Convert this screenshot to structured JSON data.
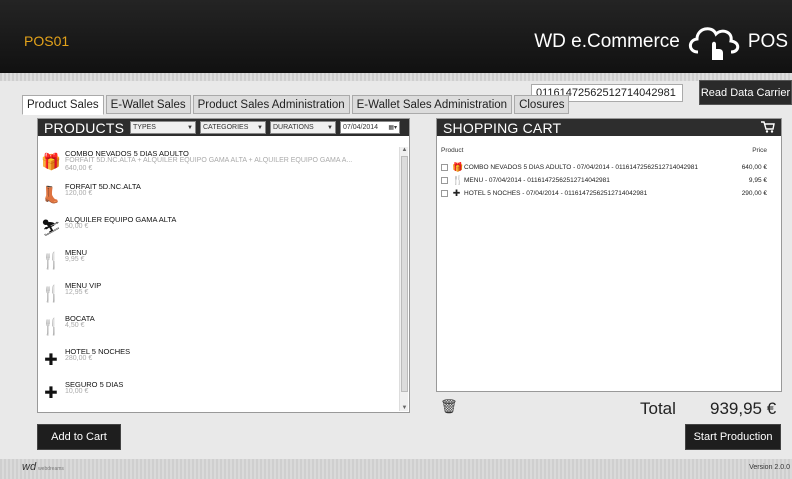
{
  "header": {
    "pos_id": "POS01",
    "brand_left": "WD e.Commerce",
    "brand_right": "POS"
  },
  "carrier": {
    "code": "01161472562512714042981",
    "read_label": "Read Data Carrier"
  },
  "tabs": [
    {
      "label": "Product Sales",
      "active": true
    },
    {
      "label": "E-Wallet Sales",
      "active": false
    },
    {
      "label": "Product Sales Administration",
      "active": false
    },
    {
      "label": "E-Wallet Sales Administration",
      "active": false
    },
    {
      "label": "Closures",
      "active": false
    }
  ],
  "products": {
    "title": "PRODUCTS",
    "filters": {
      "types": "TYPES",
      "categories": "CATEGORIES",
      "durations": "DURATIONS",
      "date": "07/04/2014"
    },
    "items": [
      {
        "icon": "combo-box-icon",
        "name": "COMBO NEVADOS 5 DIAS ADULTO",
        "desc": "FORFAIT 5D.NC.ALTA + ALQUILER EQUIPO GAMA ALTA + ALQUILER EQUIPO GAMA A...",
        "price": "640,00 €"
      },
      {
        "icon": "ski-boot-icon",
        "name": "FORFAIT 5D.NC.ALTA",
        "desc": "",
        "price": "120,00 €"
      },
      {
        "icon": "skier-icon",
        "name": "ALQUILER EQUIPO GAMA ALTA",
        "desc": "",
        "price": "50,00 €"
      },
      {
        "icon": "cutlery-icon",
        "name": "MENU",
        "desc": "",
        "price": "9,95 €"
      },
      {
        "icon": "cutlery-icon",
        "name": "MENU VIP",
        "desc": "",
        "price": "12,95 €"
      },
      {
        "icon": "cutlery-icon",
        "name": "BOCATA",
        "desc": "",
        "price": "4,50 €"
      },
      {
        "icon": "cross-icon",
        "name": "HOTEL 5 NOCHES",
        "desc": "",
        "price": "280,00 €"
      },
      {
        "icon": "cross-icon",
        "name": "SEGURO 5 DIAS",
        "desc": "",
        "price": "10,00 €"
      }
    ]
  },
  "cart": {
    "title": "SHOPPING CART",
    "col_product": "Product",
    "col_price": "Price",
    "rows": [
      {
        "icon": "combo-box-icon",
        "text": "COMBO NEVADOS 5 DIAS ADULTO - 07/04/2014 - 01161472562512714042981",
        "price": "640,00 €"
      },
      {
        "icon": "cutlery-icon",
        "text": "MENU - 07/04/2014 - 01161472562512714042981",
        "price": "9,95 €"
      },
      {
        "icon": "cross-icon",
        "text": "HOTEL 5 NOCHES - 07/04/2014 - 01161472562512714042981",
        "price": "290,00 €"
      }
    ],
    "total_label": "Total",
    "total_value": "939,95 €"
  },
  "actions": {
    "add_to_cart": "Add to Cart",
    "start_production": "Start Production"
  },
  "footer": {
    "logo": "wd",
    "logo_sub": "webdreams",
    "version": "Version 2.0.0"
  },
  "colors": {
    "pos_id": "#e3a21a",
    "header_bg": "#1a1a1a",
    "panel_head": "#2d2d2d"
  }
}
